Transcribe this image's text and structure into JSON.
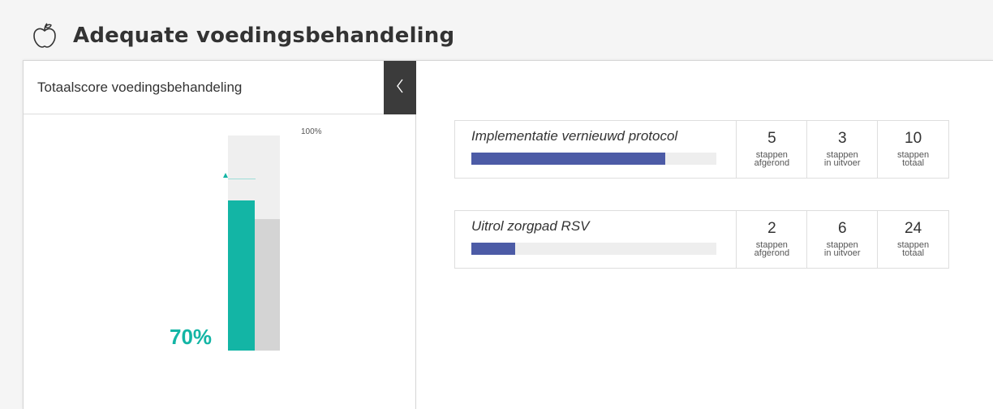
{
  "page": {
    "title": "Adequate voedingsbehandeling",
    "icon": "apple-icon"
  },
  "colors": {
    "accent": "#13b5a5",
    "progress": "#4c5ba6",
    "collapse_bg": "#3b3b3b"
  },
  "score_panel": {
    "title": "Totaalscore voedingsbehandeling",
    "collapse_icon": "chevron-left-icon",
    "max_label": "100%",
    "value_label": "70%",
    "value_fraction": 0.7,
    "comparison_fraction": 0.61,
    "target_fraction": 0.79
  },
  "projects": [
    {
      "name": "Implementatie vernieuwd protocol",
      "progress_fraction": 0.79,
      "stats": [
        {
          "value": "5",
          "label_line1": "stappen",
          "label_line2": "afgerond"
        },
        {
          "value": "3",
          "label_line1": "stappen",
          "label_line2": "in uitvoer"
        },
        {
          "value": "10",
          "label_line1": "stappen",
          "label_line2": "totaal"
        }
      ]
    },
    {
      "name": "Uitrol zorgpad RSV",
      "progress_fraction": 0.18,
      "stats": [
        {
          "value": "2",
          "label_line1": "stappen",
          "label_line2": "afgerond"
        },
        {
          "value": "6",
          "label_line1": "stappen",
          "label_line2": "in uitvoer"
        },
        {
          "value": "24",
          "label_line1": "stappen",
          "label_line2": "totaal"
        }
      ]
    }
  ]
}
